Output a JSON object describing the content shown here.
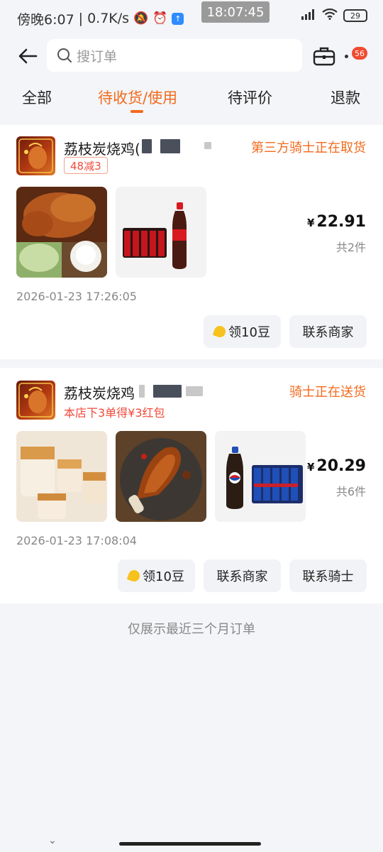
{
  "status_bar": {
    "time_label": "傍晚6:07",
    "net_speed": "0.7K/s",
    "center_clock": "18:07:45",
    "battery": "29"
  },
  "header": {
    "search_placeholder": "搜订单",
    "notif_count": "56"
  },
  "tabs": [
    {
      "label": "全部"
    },
    {
      "label": "待收货/使用",
      "active": true
    },
    {
      "label": "待评价"
    },
    {
      "label": "退款"
    }
  ],
  "orders": [
    {
      "shop_name": "荔枝炭烧鸡(",
      "status": "第三方骑士正在取货",
      "promo": "48减3",
      "price_symbol": "¥",
      "price": "22.91",
      "qty": "共2件",
      "time": "2026-01-23 17:26:05",
      "actions": [
        "领10豆",
        "联系商家"
      ]
    },
    {
      "shop_name": "荔枝炭烧鸡",
      "status": "骑士正在送货",
      "promo": "本店下3单得¥3红包",
      "price_symbol": "¥",
      "price": "20.29",
      "qty": "共6件",
      "time": "2026-01-23 17:08:04",
      "actions": [
        "领10豆",
        "联系商家",
        "联系骑士"
      ]
    }
  ],
  "footer_note": "仅展示最近三个月订单",
  "colors": {
    "accent": "#f36a1c",
    "promo_red": "#ef4b3a",
    "background": "#f3f5f8"
  }
}
